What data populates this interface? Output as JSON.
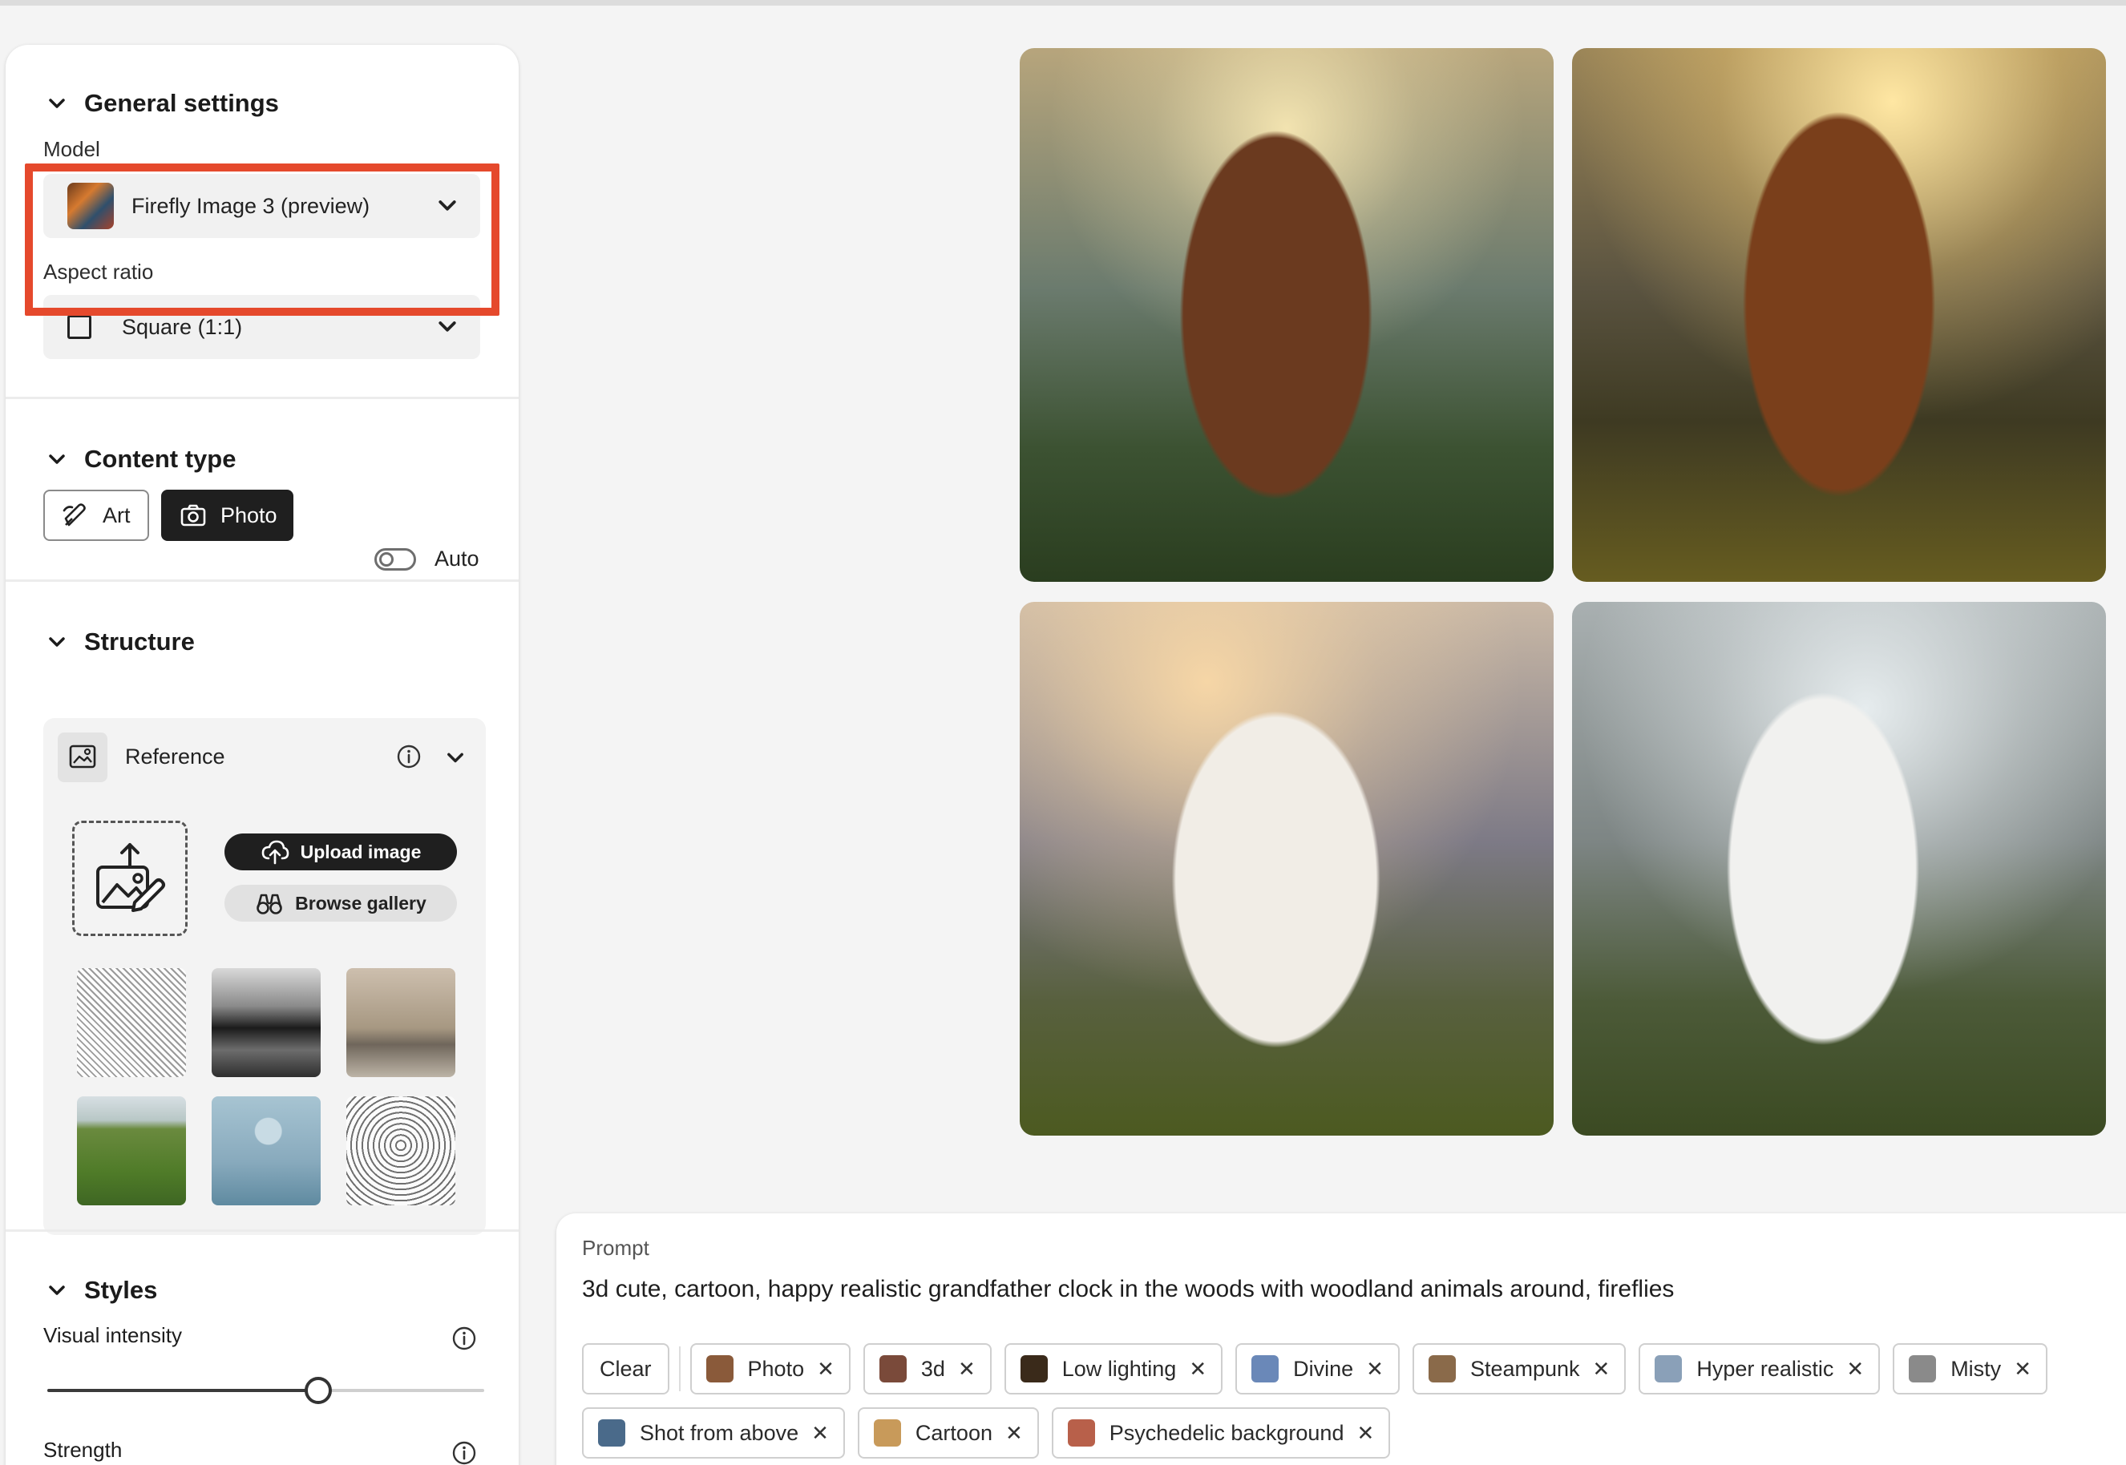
{
  "general_settings": {
    "title": "General settings",
    "model_label": "Model",
    "model_value": "Firefly Image 3 (preview)",
    "aspect_label": "Aspect ratio",
    "aspect_value": "Square (1:1)"
  },
  "content_type": {
    "title": "Content type",
    "art_label": "Art",
    "photo_label": "Photo",
    "auto_label": "Auto",
    "selected": "Photo",
    "auto_on": false
  },
  "structure": {
    "title": "Structure",
    "reference_label": "Reference",
    "upload_label": "Upload image",
    "browse_label": "Browse gallery"
  },
  "styles": {
    "title": "Styles",
    "visual_intensity_label": "Visual intensity",
    "visual_intensity_value": 0.62,
    "strength_label": "Strength"
  },
  "prompt": {
    "label": "Prompt",
    "text": "3d cute, cartoon, happy realistic grandfather clock in the woods with woodland animals around, fireflies"
  },
  "chips": {
    "clear_label": "Clear",
    "row1": [
      {
        "label": "Photo",
        "color": "#8a5a3a"
      },
      {
        "label": "3d",
        "color": "#7a4a3a"
      },
      {
        "label": "Low lighting",
        "color": "#3a2a1a"
      },
      {
        "label": "Divine",
        "color": "#6a88b8"
      },
      {
        "label": "Steampunk",
        "color": "#8a6a4a"
      },
      {
        "label": "Hyper realistic",
        "color": "#8aa0b8"
      },
      {
        "label": "Misty",
        "color": "#8a8a8a"
      }
    ],
    "row2": [
      {
        "label": "Shot from above",
        "color": "#4a6a8a"
      },
      {
        "label": "Cartoon",
        "color": "#c89a5a"
      },
      {
        "label": "Psychedelic background",
        "color": "#b8604a"
      }
    ]
  },
  "colors": {
    "highlight": "#e5492c",
    "panel_bg": "#ffffff",
    "page_bg": "#f4f4f4"
  }
}
